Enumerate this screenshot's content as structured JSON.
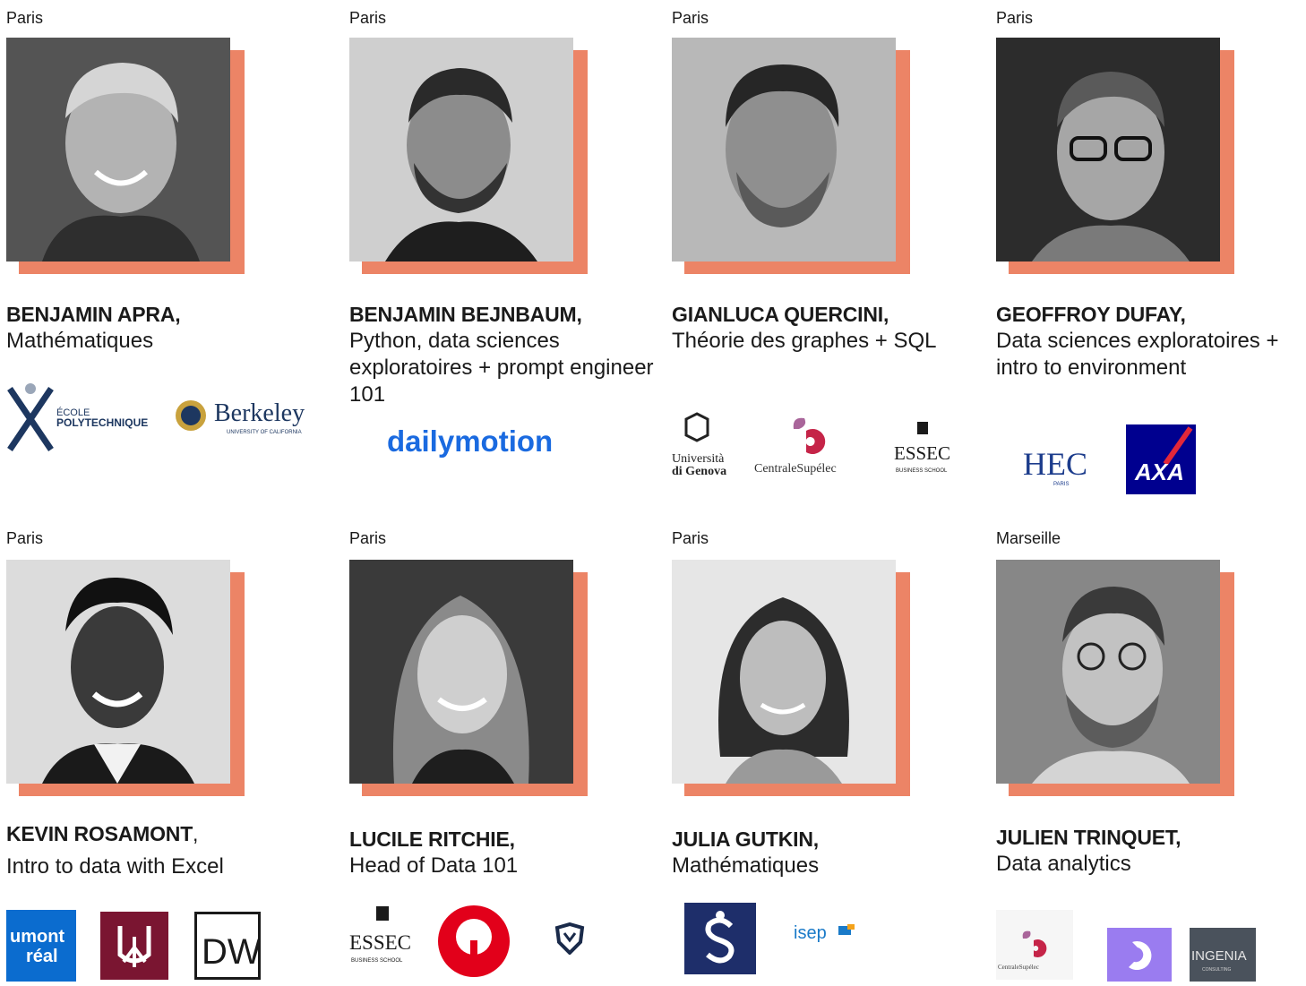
{
  "instructors": [
    {
      "city": "Paris",
      "name": "BENJAMIN APRA,",
      "subject": "Mathématiques"
    },
    {
      "city": "Paris",
      "name": "BENJAMIN BEJNBAUM,",
      "subject": "Python, data sciences exploratoires + prompt engineer 101"
    },
    {
      "city": "Paris",
      "name": "GIANLUCA QUERCINI,",
      "subject": "Théorie des graphes + SQL"
    },
    {
      "city": "Paris",
      "name": "GEOFFROY DUFAY,",
      "subject": "Data sciences exploratoires + intro to environment"
    },
    {
      "city": "Paris",
      "name": "KEVIN ROSAMONT",
      "name_suffix": ",",
      "subject": "Intro to data with Excel"
    },
    {
      "city": "Paris",
      "name": "LUCILE RITCHIE,",
      "subject": "Head of Data 101"
    },
    {
      "city": "Paris",
      "name": "JULIA GUTKIN,",
      "subject": "Mathématiques"
    },
    {
      "city": "Marseille",
      "name": "JULIEN TRINQUET,",
      "subject": "Data analytics"
    }
  ],
  "logos": {
    "polytechnique": {
      "line1": "ÉCOLE",
      "line2": "POLYTECHNIQUE"
    },
    "berkeley": {
      "word": "Berkeley",
      "sub": "UNIVERSITY OF CALIFORNIA"
    },
    "dailymotion": {
      "word": "dailymotion"
    },
    "genova": {
      "line1": "Università",
      "line2": "di Genova"
    },
    "centrale": {
      "word": "CentraleSupélec"
    },
    "essec": {
      "word": "ESSEC",
      "sub": "BUSINESS SCHOOL"
    },
    "hec": {
      "word": "HEC",
      "sub": "PARIS"
    },
    "axa": {
      "word": "AXA"
    },
    "umontreal": {
      "line1": "umont",
      "line2": "réal"
    },
    "dw": {
      "word": "DW"
    },
    "isep": {
      "word": "isep"
    },
    "ingenia": {
      "word": "INGENIA",
      "sub": "CONSULTING"
    }
  },
  "colors": {
    "accent": "#ec8466",
    "text": "#1a1a1a"
  }
}
